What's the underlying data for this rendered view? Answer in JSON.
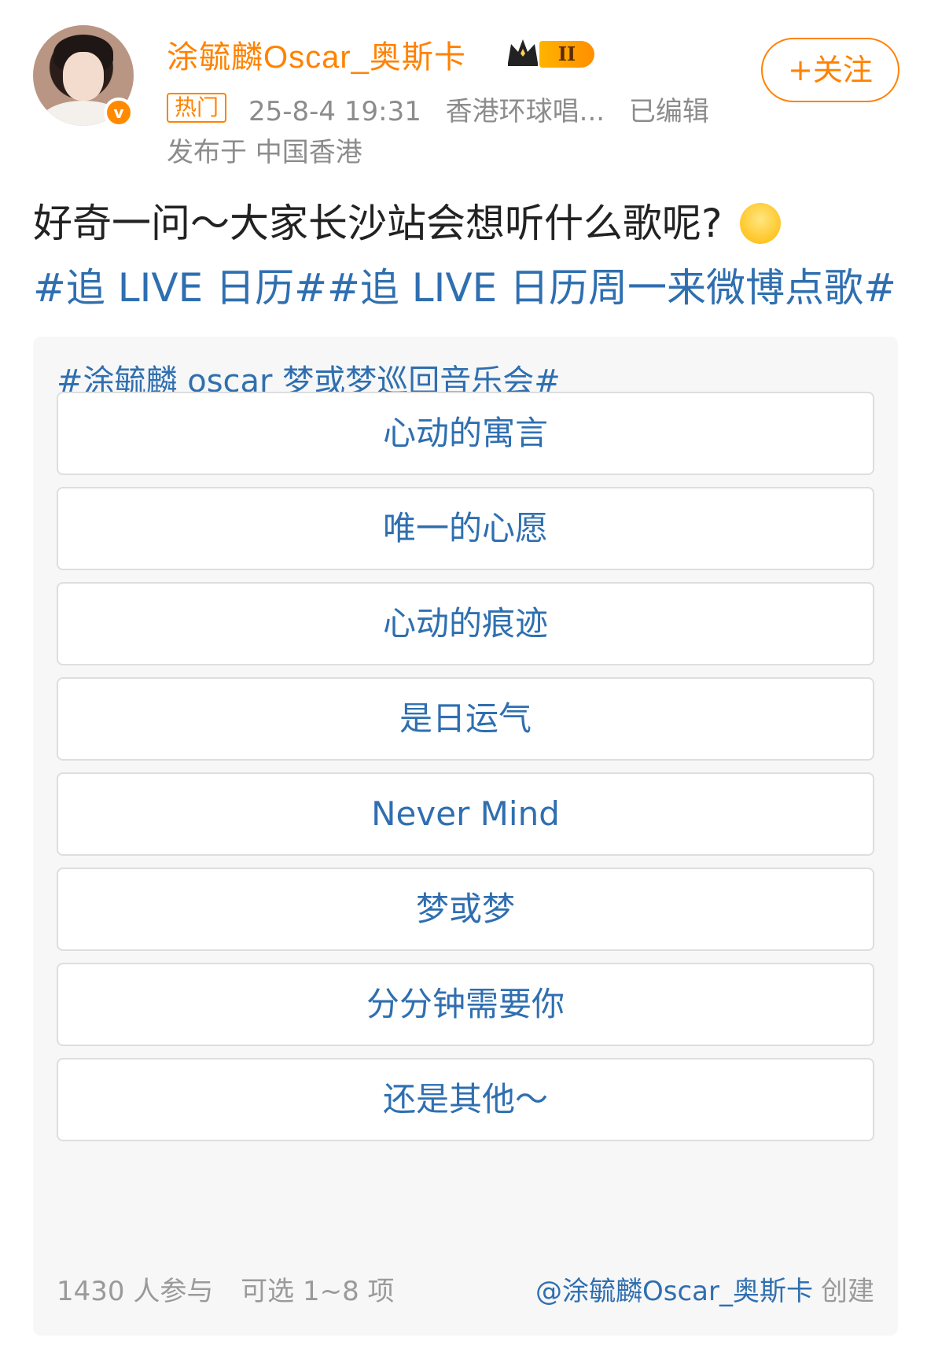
{
  "post": {
    "username": "涂毓麟Oscar_奥斯卡",
    "level_badge": "II",
    "follow_label": "+关注",
    "hot_tag": "热门",
    "timestamp": "25-8-4 19:31",
    "source": "香港环球唱...",
    "edited": "已编辑",
    "location": "发布于 中国香港",
    "text": "好奇一问～大家长沙站会想听什么歌呢?",
    "hashtags": "#追 LIVE 日历##追 LIVE 日历周一来微博点歌#"
  },
  "poll": {
    "title": "#涂毓麟 oscar 梦或梦巡回音乐会#",
    "options": [
      "心动的寓言",
      "唯一的心愿",
      "心动的痕迹",
      "是日运气",
      "Never Mind",
      "梦或梦",
      "分分钟需要你",
      "还是其他～"
    ],
    "participants": "1430 人参与",
    "selectable": "可选 1~8 项",
    "creator": "@涂毓麟Oscar_奥斯卡",
    "creator_suffix": "创建"
  },
  "colors": {
    "brand_orange": "#ff8200",
    "link_blue": "#2f6fb0"
  },
  "icons": [
    "avatar",
    "verified-icon",
    "crown-icon",
    "smile-emoji-icon"
  ]
}
